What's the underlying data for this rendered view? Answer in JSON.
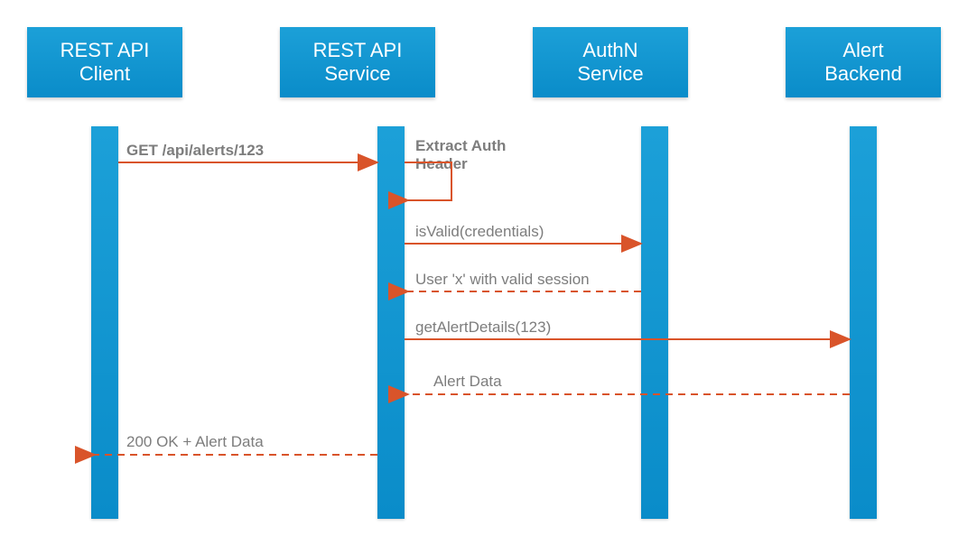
{
  "participants": {
    "client": {
      "label": "REST API\nClient"
    },
    "service": {
      "label": "REST API\nService"
    },
    "authn": {
      "label": "AuthN\nService"
    },
    "backend": {
      "label": "Alert\nBackend"
    }
  },
  "messages": {
    "m1": {
      "label": "GET /api/alerts/123",
      "from": "client",
      "to": "service",
      "style": "solid"
    },
    "m2": {
      "label": "Extract Auth\nHeader",
      "from": "service",
      "to": "service",
      "style": "self"
    },
    "m3": {
      "label": "isValid(credentials)",
      "from": "service",
      "to": "authn",
      "style": "solid"
    },
    "m4": {
      "label": "User 'x' with valid session",
      "from": "authn",
      "to": "service",
      "style": "dashed"
    },
    "m5": {
      "label": "getAlertDetails(123)",
      "from": "service",
      "to": "backend",
      "style": "solid"
    },
    "m6": {
      "label": "Alert Data",
      "from": "backend",
      "to": "service",
      "style": "dashed"
    },
    "m7": {
      "label": "200 OK + Alert Data",
      "from": "service",
      "to": "client",
      "style": "dashed"
    }
  },
  "colors": {
    "box": "#0a8cc9",
    "arrow": "#d9542a",
    "label": "#7d7d7d"
  }
}
